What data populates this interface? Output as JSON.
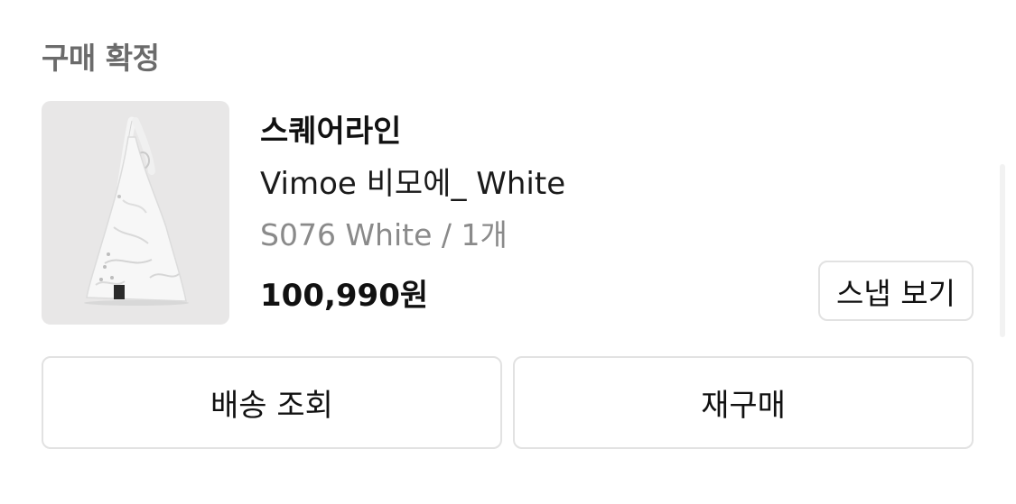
{
  "order": {
    "status_label": "구매 확정"
  },
  "product": {
    "brand": "스퀘어라인",
    "name": "Vimoe 비모에_ White",
    "option": "S076 White / 1개",
    "price": "100,990원",
    "image_icon": "tote-bag-image",
    "snap_button_label": "스냅 보기"
  },
  "actions": {
    "shipping_label": "배송 조회",
    "reorder_label": "재구매"
  },
  "colors": {
    "status_gray": "#6b6b6b",
    "option_gray": "#8a8a8a",
    "border": "#e2e2e2",
    "thumb_bg": "#e8e7e7"
  }
}
